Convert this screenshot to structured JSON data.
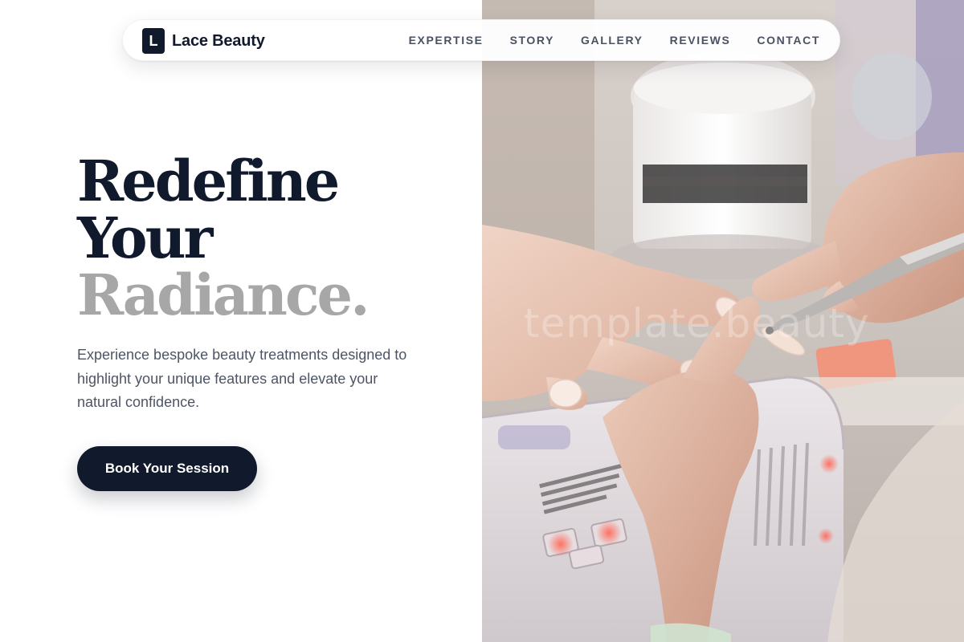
{
  "brand": {
    "mark": "L",
    "name": "Lace Beauty"
  },
  "nav": {
    "items": [
      {
        "label": "EXPERTISE"
      },
      {
        "label": "STORY"
      },
      {
        "label": "GALLERY"
      },
      {
        "label": "REVIEWS"
      },
      {
        "label": "CONTACT"
      }
    ]
  },
  "hero": {
    "title_line1": "Redefine",
    "title_line2": "Your",
    "title_line3": "Radiance.",
    "subtitle": "Experience bespoke beauty treatments designed to highlight your unique features and elevate your natural confidence.",
    "cta_label": "Book Your Session"
  },
  "photo": {
    "alt": "Manicurist shaping a client's nails",
    "watermark": "template.beauty"
  },
  "colors": {
    "navy": "#111a2c",
    "muted_title": "#a7a7a7",
    "body_text": "#4d5564",
    "nav_text": "#4a5261"
  }
}
